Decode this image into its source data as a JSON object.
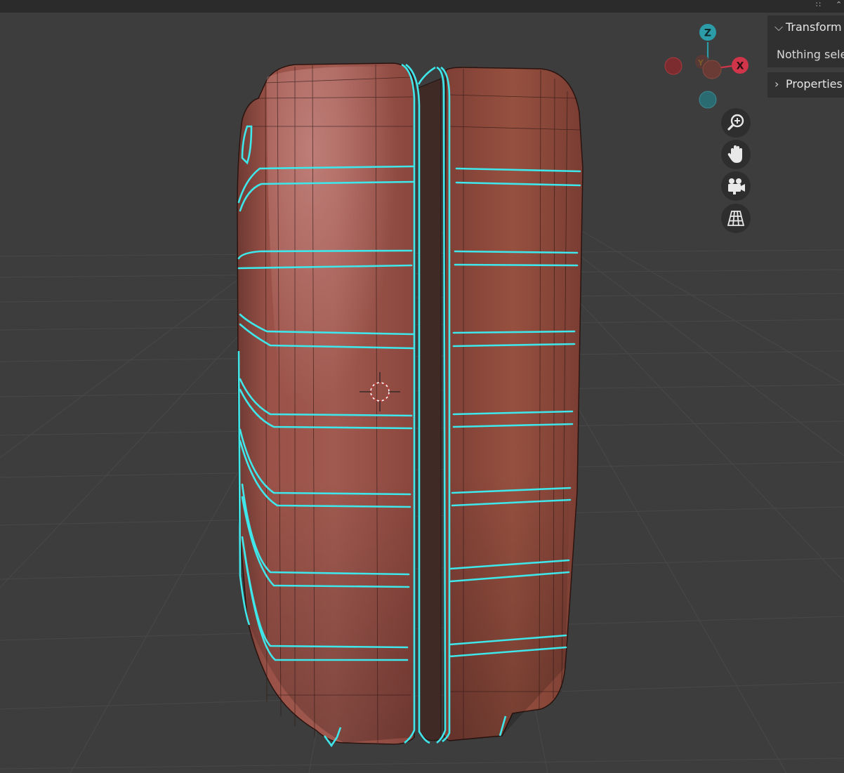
{
  "sidebar": {
    "transform": {
      "title": "Transform",
      "status": "Nothing sele"
    },
    "properties": {
      "title": "Properties"
    }
  },
  "gizmo": {
    "z_label": "Z",
    "x_label": "X",
    "y_label": "Y",
    "colors": {
      "x": "#d13549",
      "y": "#8ab82e",
      "z": "#2b9ca8"
    }
  },
  "nav_buttons": [
    "zoom-icon",
    "hand-icon",
    "camera-icon",
    "grid-icon"
  ],
  "object": {
    "base_color": "#8d4a3f",
    "outline_color": "#3fe6ea"
  }
}
